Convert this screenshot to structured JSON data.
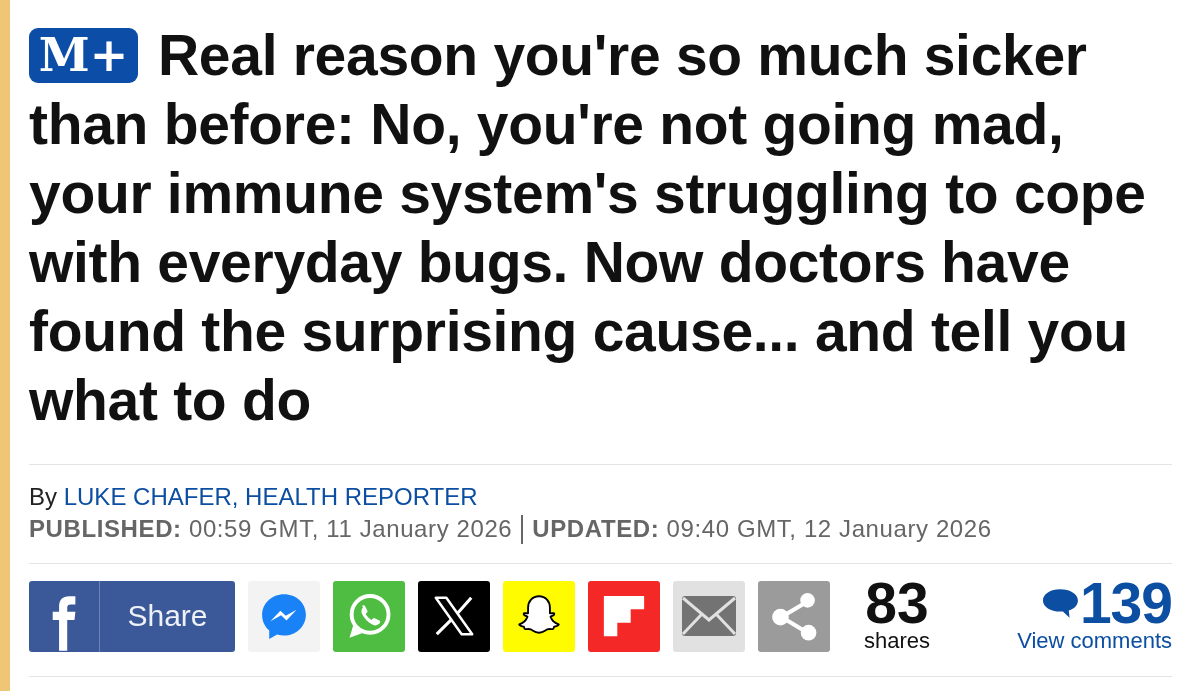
{
  "article": {
    "badge": "M+",
    "headline": "Real reason you're so much sicker than before: No, you're not going mad, your immune system's struggling to cope with everyday bugs. Now doctors have found the surprising cause... and tell you what to do",
    "byline": {
      "prefix": "By",
      "author": "LUKE CHAFER, HEALTH REPORTER"
    },
    "published": "**PUBLISHED:** 00:59 GMT, 11 January 2026",
    "updated": "**UPDATED:** 09:40 GMT, 12 January 2026"
  },
  "share_bar": {
    "buttons": [
      {
        "kind": "facebook",
        "label": "Share"
      },
      {
        "kind": "messenger"
      },
      {
        "kind": "whatsapp"
      },
      {
        "kind": "x"
      },
      {
        "kind": "snapchat"
      },
      {
        "kind": "flipboard"
      },
      {
        "kind": "email"
      },
      {
        "kind": "share"
      }
    ],
    "share_count": "83",
    "share_label": "shares",
    "comment_count": "139",
    "comments_link": "View comments"
  }
}
